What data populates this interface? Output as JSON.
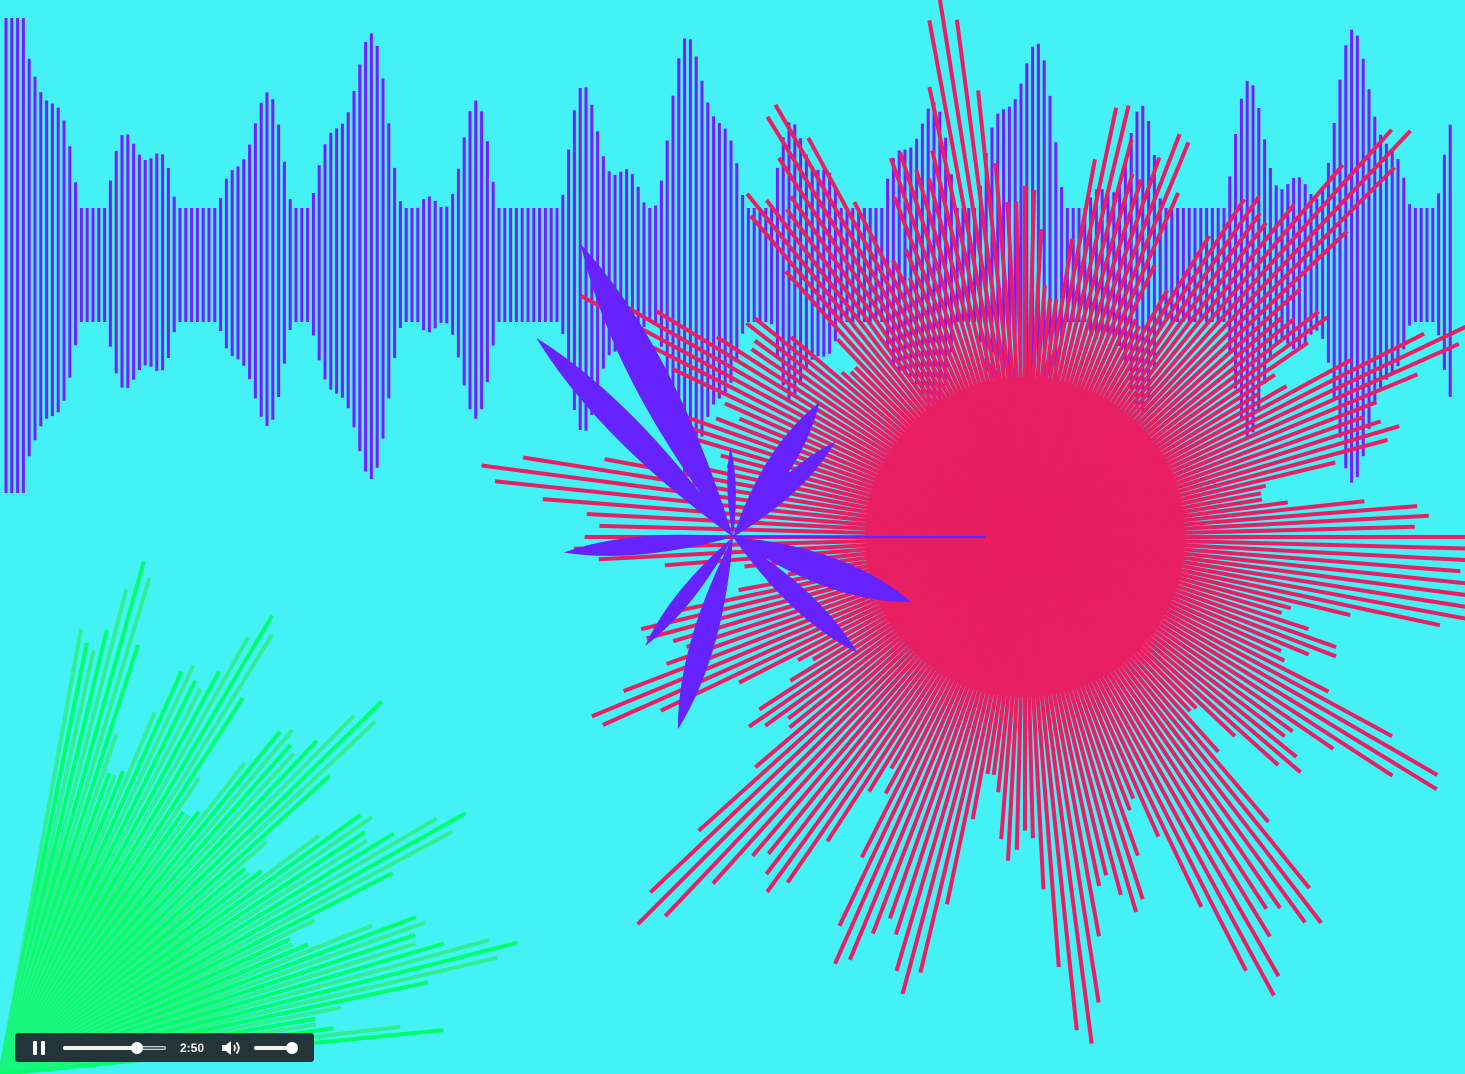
{
  "colors": {
    "background": "#44f2f5",
    "waveform": "#7b1cff",
    "burst": "#e81f62",
    "flower": "#6622ff",
    "fan_start": "#00ff6a",
    "fan_end": "#2fef90"
  },
  "player": {
    "time": "2:50",
    "progress": 0.72,
    "volume": 0.9,
    "play_icon": "pause-icon",
    "volume_icon": "speaker-icon"
  }
}
